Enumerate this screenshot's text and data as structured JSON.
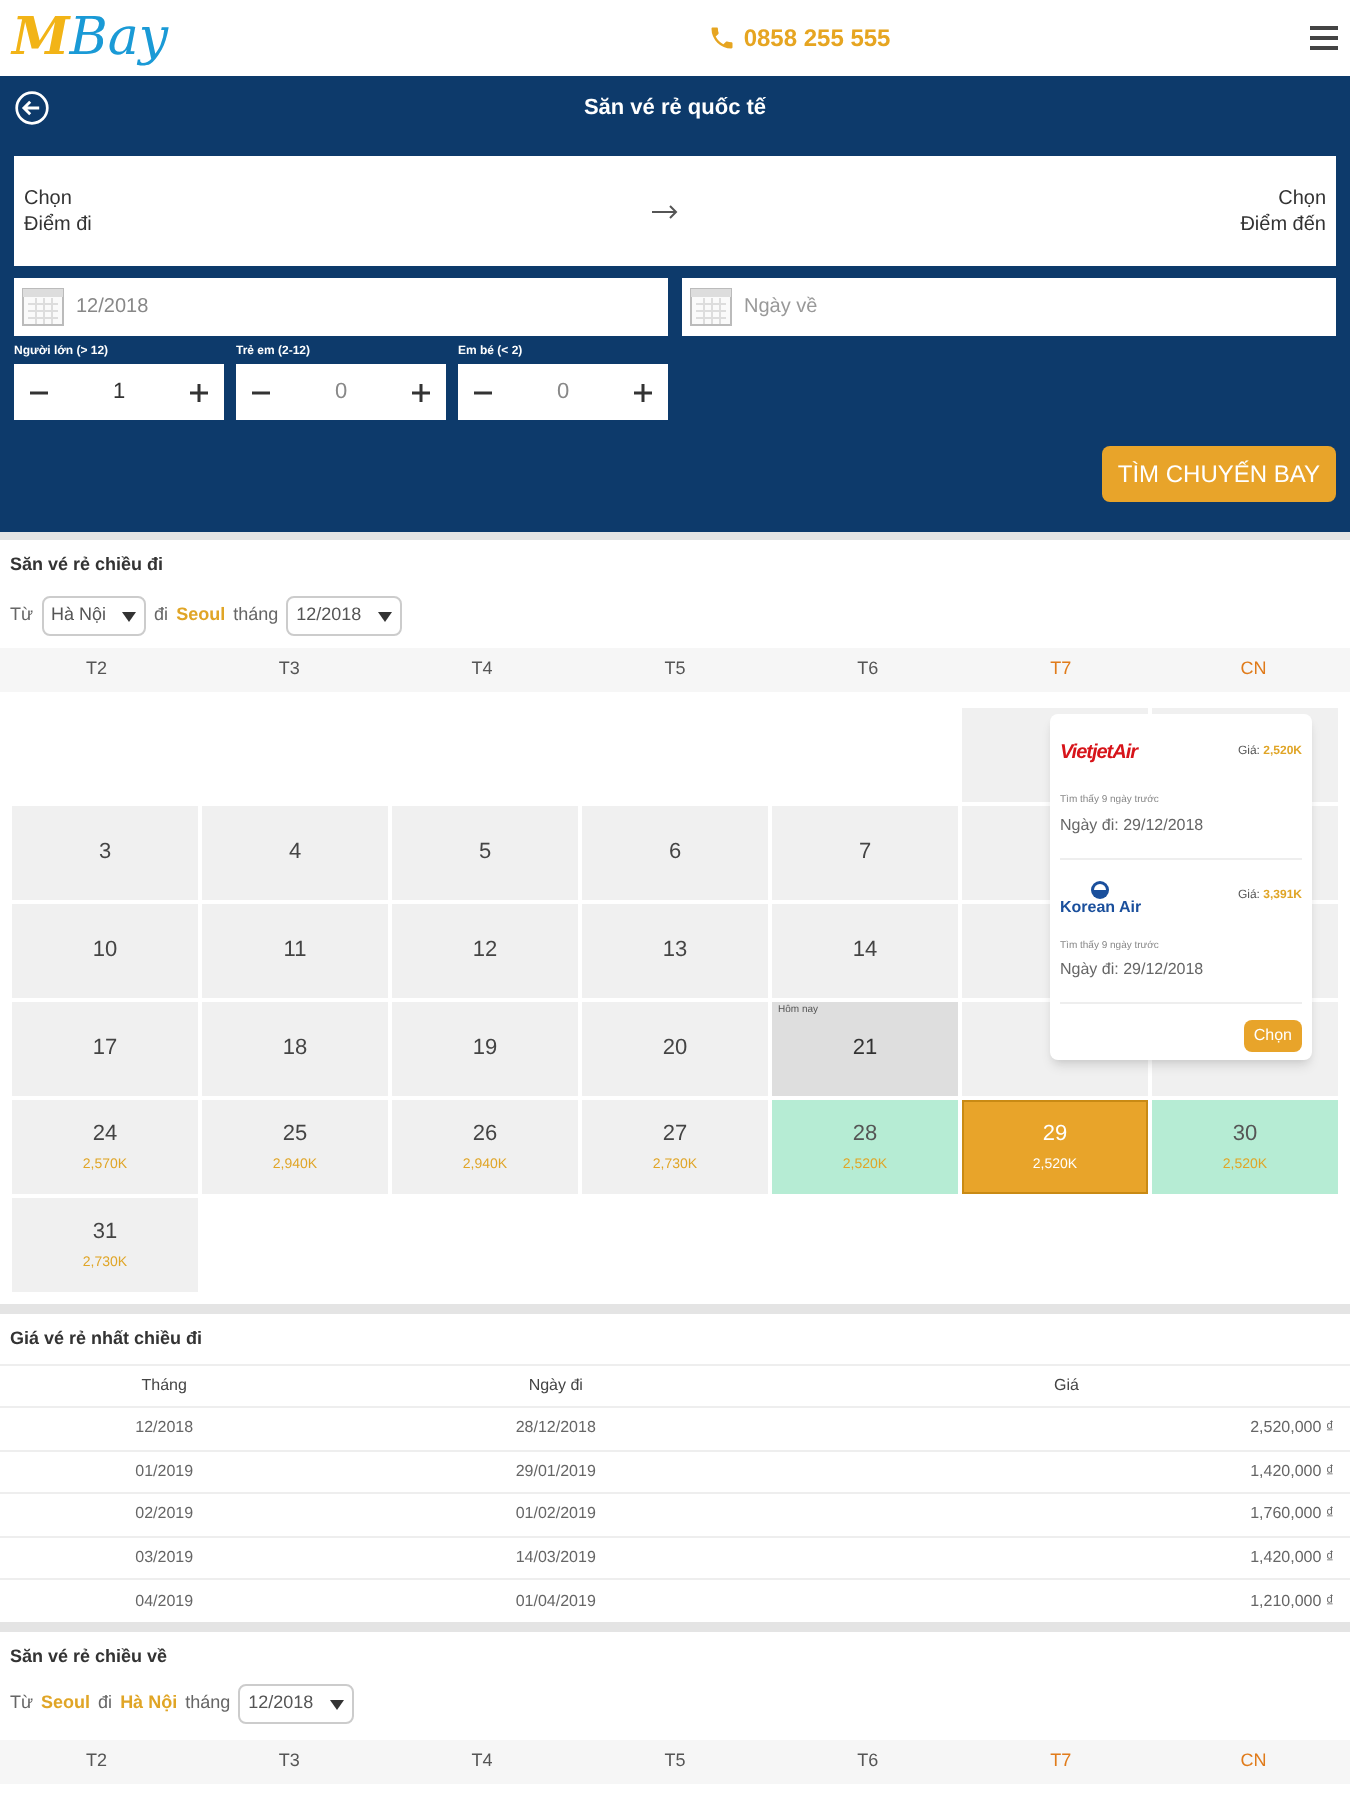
{
  "header": {
    "logo_first": "M",
    "logo_rest": "Bay",
    "phone": "0858 255 555"
  },
  "search": {
    "title": "Săn vé rẻ quốc tế",
    "from": "Chọn\nĐiểm đi",
    "to": "Chọn\nĐiểm đến",
    "depart_date": "12/2018",
    "return_placeholder": "Ngày về",
    "passengers": [
      {
        "label": "Người lớn (> 12)",
        "value": "1"
      },
      {
        "label": "Trẻ em (2-12)",
        "value": "0"
      },
      {
        "label": "Em bé (< 2)",
        "value": "0"
      }
    ],
    "submit": "TÌM CHUYẾN BAY"
  },
  "outbound": {
    "title": "Săn vé rẻ chiều đi",
    "from_label": "Từ",
    "from": "Hà Nội",
    "to_label": "đi",
    "to": "Seoul",
    "month_label": "tháng",
    "month": "12/2018",
    "weekdays": [
      {
        "label": "T2",
        "weekend": false
      },
      {
        "label": "T3",
        "weekend": false
      },
      {
        "label": "T4",
        "weekend": false
      },
      {
        "label": "T5",
        "weekend": false
      },
      {
        "label": "T6",
        "weekend": false
      },
      {
        "label": "T7",
        "weekend": true
      },
      {
        "label": "CN",
        "weekend": true
      }
    ],
    "cells": [
      {
        "kind": "blank"
      },
      {
        "kind": "blank"
      },
      {
        "kind": "blank"
      },
      {
        "kind": "blank"
      },
      {
        "kind": "blank"
      },
      {
        "kind": "hidden"
      },
      {
        "kind": "hidden"
      },
      {
        "kind": "day",
        "day": "3"
      },
      {
        "kind": "day",
        "day": "4"
      },
      {
        "kind": "day",
        "day": "5"
      },
      {
        "kind": "day",
        "day": "6"
      },
      {
        "kind": "day",
        "day": "7"
      },
      {
        "kind": "hidden"
      },
      {
        "kind": "hidden"
      },
      {
        "kind": "day",
        "day": "10"
      },
      {
        "kind": "day",
        "day": "11"
      },
      {
        "kind": "day",
        "day": "12"
      },
      {
        "kind": "day",
        "day": "13"
      },
      {
        "kind": "day",
        "day": "14"
      },
      {
        "kind": "hidden"
      },
      {
        "kind": "hidden"
      },
      {
        "kind": "day",
        "day": "17"
      },
      {
        "kind": "day",
        "day": "18"
      },
      {
        "kind": "day",
        "day": "19"
      },
      {
        "kind": "day",
        "day": "20"
      },
      {
        "kind": "today",
        "day": "21",
        "note": "Hôm nay"
      },
      {
        "kind": "hidden"
      },
      {
        "kind": "hidden"
      },
      {
        "kind": "day",
        "day": "24",
        "price": "2,570K"
      },
      {
        "kind": "day",
        "day": "25",
        "price": "2,940K"
      },
      {
        "kind": "day",
        "day": "26",
        "price": "2,940K"
      },
      {
        "kind": "day",
        "day": "27",
        "price": "2,730K"
      },
      {
        "kind": "cheap",
        "day": "28",
        "price": "2,520K"
      },
      {
        "kind": "selected",
        "day": "29",
        "price": "2,520K"
      },
      {
        "kind": "cheap",
        "day": "30",
        "price": "2,520K"
      },
      {
        "kind": "day",
        "day": "31",
        "price": "2,730K"
      }
    ],
    "popup": {
      "offers": [
        {
          "airline": "VietjetAir",
          "kind": "vietjet",
          "price_label": "Giá:",
          "price": "2,520K",
          "found": "Tìm thấy 9 ngày trước",
          "date": "Ngày đi: 29/12/2018"
        },
        {
          "airline": "Korean Air",
          "kind": "korean",
          "price_label": "Giá:",
          "price": "3,391K",
          "found": "Tìm thấy 9 ngày trước",
          "date": "Ngày đi: 29/12/2018"
        }
      ],
      "button": "Chọn"
    }
  },
  "cheapest": {
    "title": "Giá vé rẻ nhất chiều đi",
    "columns": [
      "Tháng",
      "Ngày đi",
      "Giá"
    ],
    "rows": [
      [
        "12/2018",
        "28/12/2018",
        "2,520,000 ₫"
      ],
      [
        "01/2019",
        "29/01/2019",
        "1,420,000 ₫"
      ],
      [
        "02/2019",
        "01/02/2019",
        "1,760,000 ₫"
      ],
      [
        "03/2019",
        "14/03/2019",
        "1,420,000 ₫"
      ],
      [
        "04/2019",
        "01/04/2019",
        "1,210,000 ₫"
      ]
    ]
  },
  "return": {
    "title": "Săn vé rẻ chiều về",
    "from_label": "Từ",
    "from": "Seoul",
    "to_label": "đi",
    "to": "Hà Nội",
    "month_label": "tháng",
    "month": "12/2018",
    "weekdays": [
      {
        "label": "T2",
        "weekend": false
      },
      {
        "label": "T3",
        "weekend": false
      },
      {
        "label": "T4",
        "weekend": false
      },
      {
        "label": "T5",
        "weekend": false
      },
      {
        "label": "T6",
        "weekend": false
      },
      {
        "label": "T7",
        "weekend": true
      },
      {
        "label": "CN",
        "weekend": true
      }
    ]
  }
}
